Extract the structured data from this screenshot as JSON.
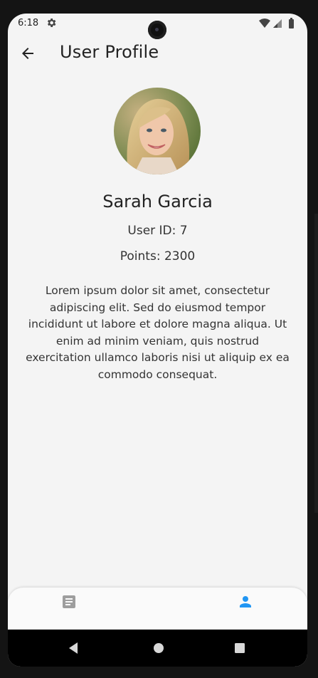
{
  "status_bar": {
    "time": "6:18"
  },
  "app_bar": {
    "title": "User Profile"
  },
  "profile": {
    "name": "Sarah Garcia",
    "user_id": "User ID: 7",
    "points": "Points: 2300",
    "bio": "Lorem ipsum dolor sit amet, consectetur adipiscing elit. Sed do eiusmod tempor incididunt ut labore et dolore magna aliqua. Ut enim ad minim veniam, quis nostrud exercitation ullamco laboris nisi ut aliquip ex ea commodo consequat."
  },
  "bottom_nav": {
    "items": [
      {
        "icon": "article-icon",
        "active": false
      },
      {
        "icon": "person-icon",
        "active": true
      }
    ]
  },
  "colors": {
    "background": "#f4f4f4",
    "accent": "#2196f3",
    "inactive_icon": "#9e9e9e",
    "text": "#222222"
  }
}
